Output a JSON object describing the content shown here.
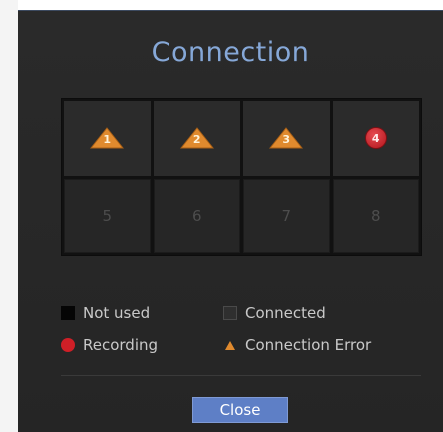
{
  "dialog": {
    "title": "Connection",
    "close_label": "Close"
  },
  "channels": [
    {
      "number": "1",
      "status": "connection-error"
    },
    {
      "number": "2",
      "status": "connection-error"
    },
    {
      "number": "3",
      "status": "connection-error"
    },
    {
      "number": "4",
      "status": "recording"
    },
    {
      "number": "5",
      "status": "not-used"
    },
    {
      "number": "6",
      "status": "not-used"
    },
    {
      "number": "7",
      "status": "not-used"
    },
    {
      "number": "8",
      "status": "not-used"
    }
  ],
  "legend": {
    "not_used": "Not used",
    "connected": "Connected",
    "recording": "Recording",
    "connection_error": "Connection Error"
  },
  "colors": {
    "title": "#86a8d8",
    "error_icon": "#e08a2e",
    "recording_icon": "#cf1f27",
    "button": "#5e7fc6"
  }
}
